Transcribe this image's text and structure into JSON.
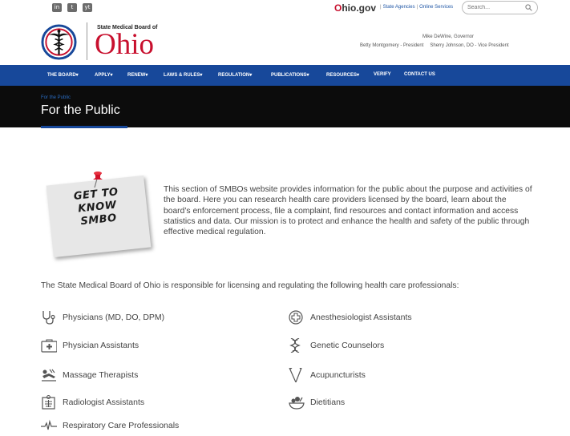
{
  "topbar": {
    "social": [
      "in",
      "t",
      "yt"
    ],
    "ohiogov_o": "O",
    "ohiogov_rest": "hio.gov",
    "links": [
      "State Agencies",
      "Online Services"
    ],
    "search_placeholder": "Search..."
  },
  "header": {
    "board_name": "State Medical Board of",
    "state_name": "Ohio",
    "governor": "Mike DeWine, Governor",
    "president": "Betty Montgomery - President",
    "vice_president": "Sherry Johnson, DO - Vice President"
  },
  "nav": {
    "items": [
      "THE BOARD▾",
      "APPLY▾",
      "RENEW▾",
      "LAWS & RULES▾",
      "REGULATION▾",
      "PUBLICATIONS▾",
      "RESOURCES▾",
      "VERIFY",
      "CONTACT US"
    ]
  },
  "hero": {
    "breadcrumb": "For the Public",
    "title": "For the Public"
  },
  "intro": {
    "note_text": "GET TO KNOW SMBO",
    "paragraph": "This section of SMBOs website provides information for the public about the purpose and activities of the board. Here you can research health care providers licensed by the board, learn about the board’s enforcement process, file a complaint, find resources and contact information and access statistics and data. Our mission is to protect and enhance the health and safety of the public through effective medical regulation."
  },
  "professions": {
    "lead": "The State Medical Board of Ohio is responsible for licensing and regulating the following health care professionals:",
    "items": [
      {
        "label": "Physicians (MD, DO, DPM)",
        "icon": "stethoscope-icon"
      },
      {
        "label": "Anesthesiologist Assistants",
        "icon": "medical-cross-icon"
      },
      {
        "label": "Physician Assistants",
        "icon": "medical-kit-icon"
      },
      {
        "label": "Genetic Counselors",
        "icon": "dna-icon"
      },
      {
        "label": "Massage Therapists",
        "icon": "massage-icon"
      },
      {
        "label": "Acupuncturists",
        "icon": "needles-icon"
      },
      {
        "label": "Radiologist Assistants",
        "icon": "xray-icon"
      },
      {
        "label": "Dietitians",
        "icon": "food-bowl-icon"
      },
      {
        "label": "Respiratory Care Professionals",
        "icon": "heartbeat-icon"
      }
    ]
  },
  "colors": {
    "nav_blue": "#17489a",
    "ohio_red": "#c8102e",
    "hero_black": "#0c0c0c"
  }
}
